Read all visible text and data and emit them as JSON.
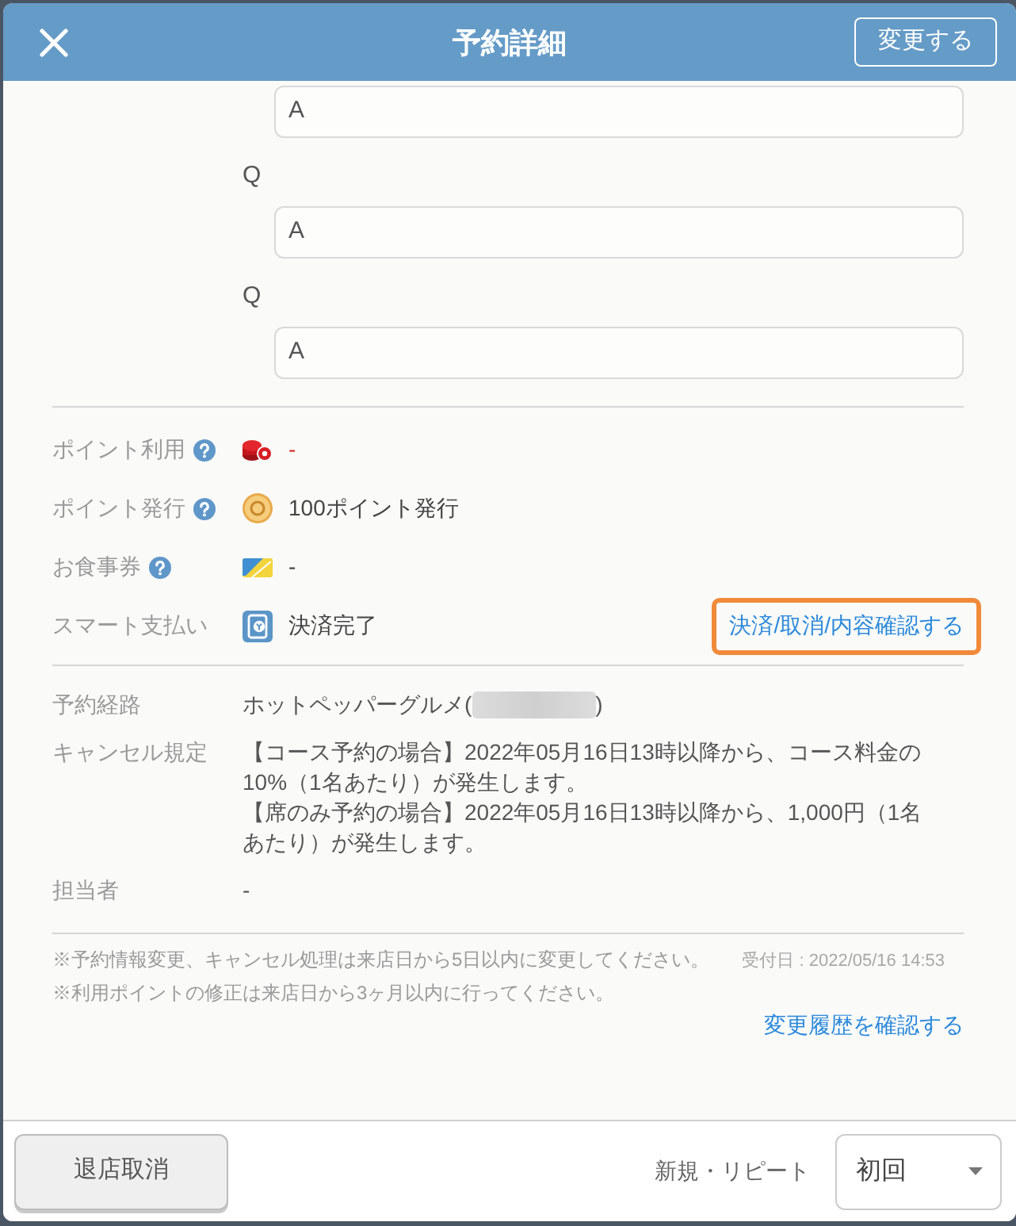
{
  "header": {
    "title": "予約詳細",
    "action_button": "変更する"
  },
  "qa": [
    {
      "answer": "A"
    },
    {
      "question": "Q",
      "answer": "A"
    },
    {
      "question": "Q",
      "answer": "A"
    }
  ],
  "payment": [
    {
      "kind": "point_use",
      "label": "ポイント利用",
      "help": true,
      "value": "-"
    },
    {
      "kind": "point_issue",
      "label": "ポイント発行",
      "help": true,
      "value": "100ポイント発行"
    },
    {
      "kind": "meal_ticket",
      "label": "お食事券",
      "help": true,
      "value": "-"
    },
    {
      "kind": "smart_pay",
      "label": "スマート支払い",
      "help": false,
      "value": "決済完了",
      "link": {
        "label": "決済/取消/内容確認する",
        "highlighted": true
      }
    }
  ],
  "details": [
    {
      "kind": "route",
      "label": "予約経路",
      "value": "ホットペッパーグルメ(",
      "redacted": true,
      "value_end": ")"
    },
    {
      "kind": "paragraphs",
      "label": "キャンセル規定",
      "paragraphs": [
        "【コース予約の場合】2022年05月16日13時以降から、コース料金の10%（1名あたり）が発生します。",
        "【席のみ予約の場合】2022年05月16日13時以降から、1,000円（1名あたり）が発生します。"
      ]
    },
    {
      "kind": "text",
      "label": "担当者",
      "value": "-"
    }
  ],
  "notes": {
    "lines": [
      "※予約情報変更、キャンセル処理は来店日から5日以内に変更してください。",
      "※利用ポイントの修正は来店日から3ヶ月以内に行ってください。"
    ],
    "received": "受付日 : 2022/05/16 14:53",
    "history_link": "変更履歴を確認する"
  },
  "footer": {
    "checkout_cancel_button": "退店取消",
    "visit_type": {
      "label": "新規・リピート",
      "value": "初回"
    }
  }
}
